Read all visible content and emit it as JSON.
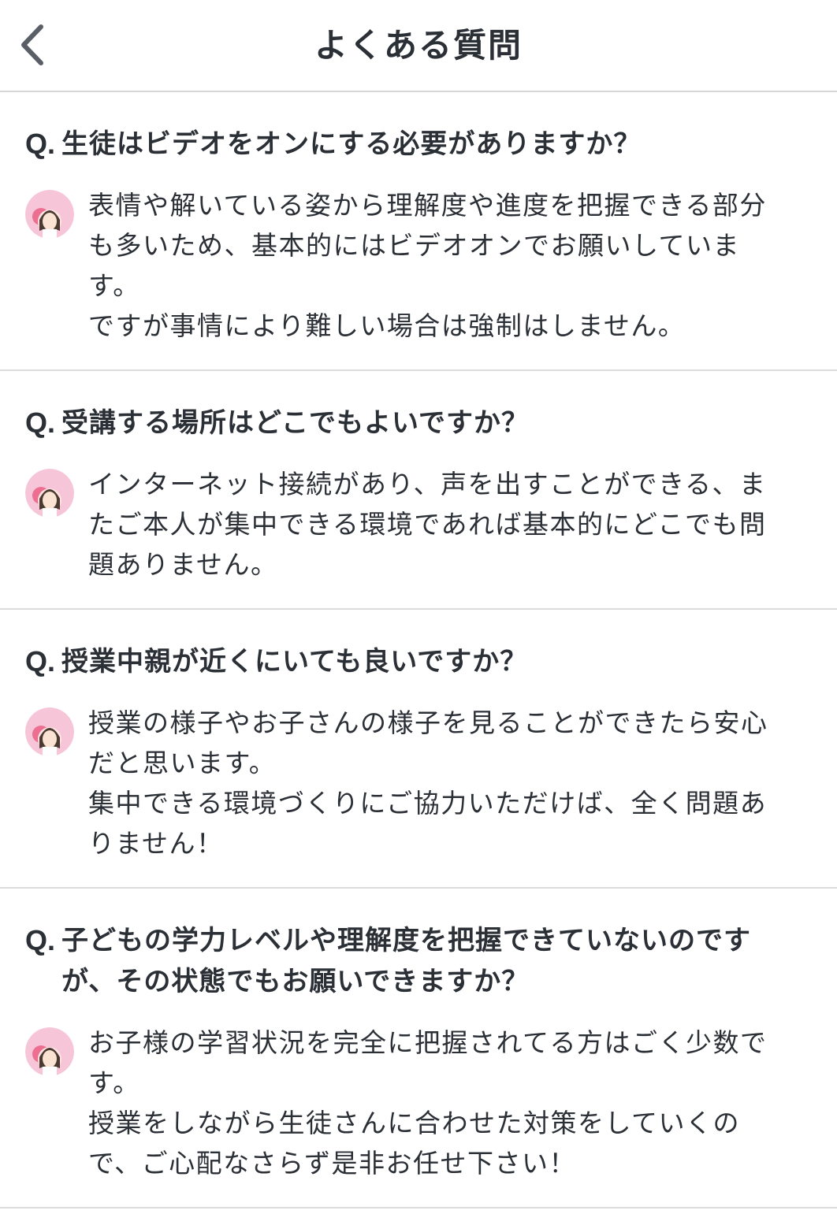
{
  "header": {
    "title": "よくある質問",
    "back_icon": "chevron-left-icon"
  },
  "colors": {
    "text": "#2b2f36",
    "divider": "#dcdcdc",
    "avatar_bg": "#f6c6d8",
    "avatar_flower": "#e8507a"
  },
  "faq": [
    {
      "q_mark": "Q.",
      "question": [
        "生徒はビデオをオンにする必要がありますか？"
      ],
      "answer": [
        "表情や解いている姿から理解度や進度を把握できる部分",
        "も多いため、基本的にはビデオオンでお願いしていま",
        "す。",
        "ですが事情により難しい場合は強制はしません。"
      ]
    },
    {
      "q_mark": "Q.",
      "question": [
        "受講する場所はどこでもよいですか？"
      ],
      "answer": [
        "インターネット接続があり、声を出すことができる、ま",
        "たご本人が集中できる環境であれば基本的にどこでも問",
        "題ありません。"
      ]
    },
    {
      "q_mark": "Q.",
      "question": [
        "授業中親が近くにいても良いですか？"
      ],
      "answer": [
        "授業の様子やお子さんの様子を見ることができたら安心",
        "だと思います。",
        "集中できる環境づくりにご協力いただけば、全く問題あ",
        "りません！"
      ]
    },
    {
      "q_mark": "Q.",
      "question": [
        "子どもの学力レベルや理解度を把握できていないのです",
        "が、その状態でもお願いできますか？"
      ],
      "answer": [
        "お子様の学習状況を完全に把握されてる方はごく少数で",
        "す。",
        "授業をしながら生徒さんに合わせた対策をしていくの",
        "で、ご心配なさらず是非お任せ下さい！"
      ]
    }
  ]
}
